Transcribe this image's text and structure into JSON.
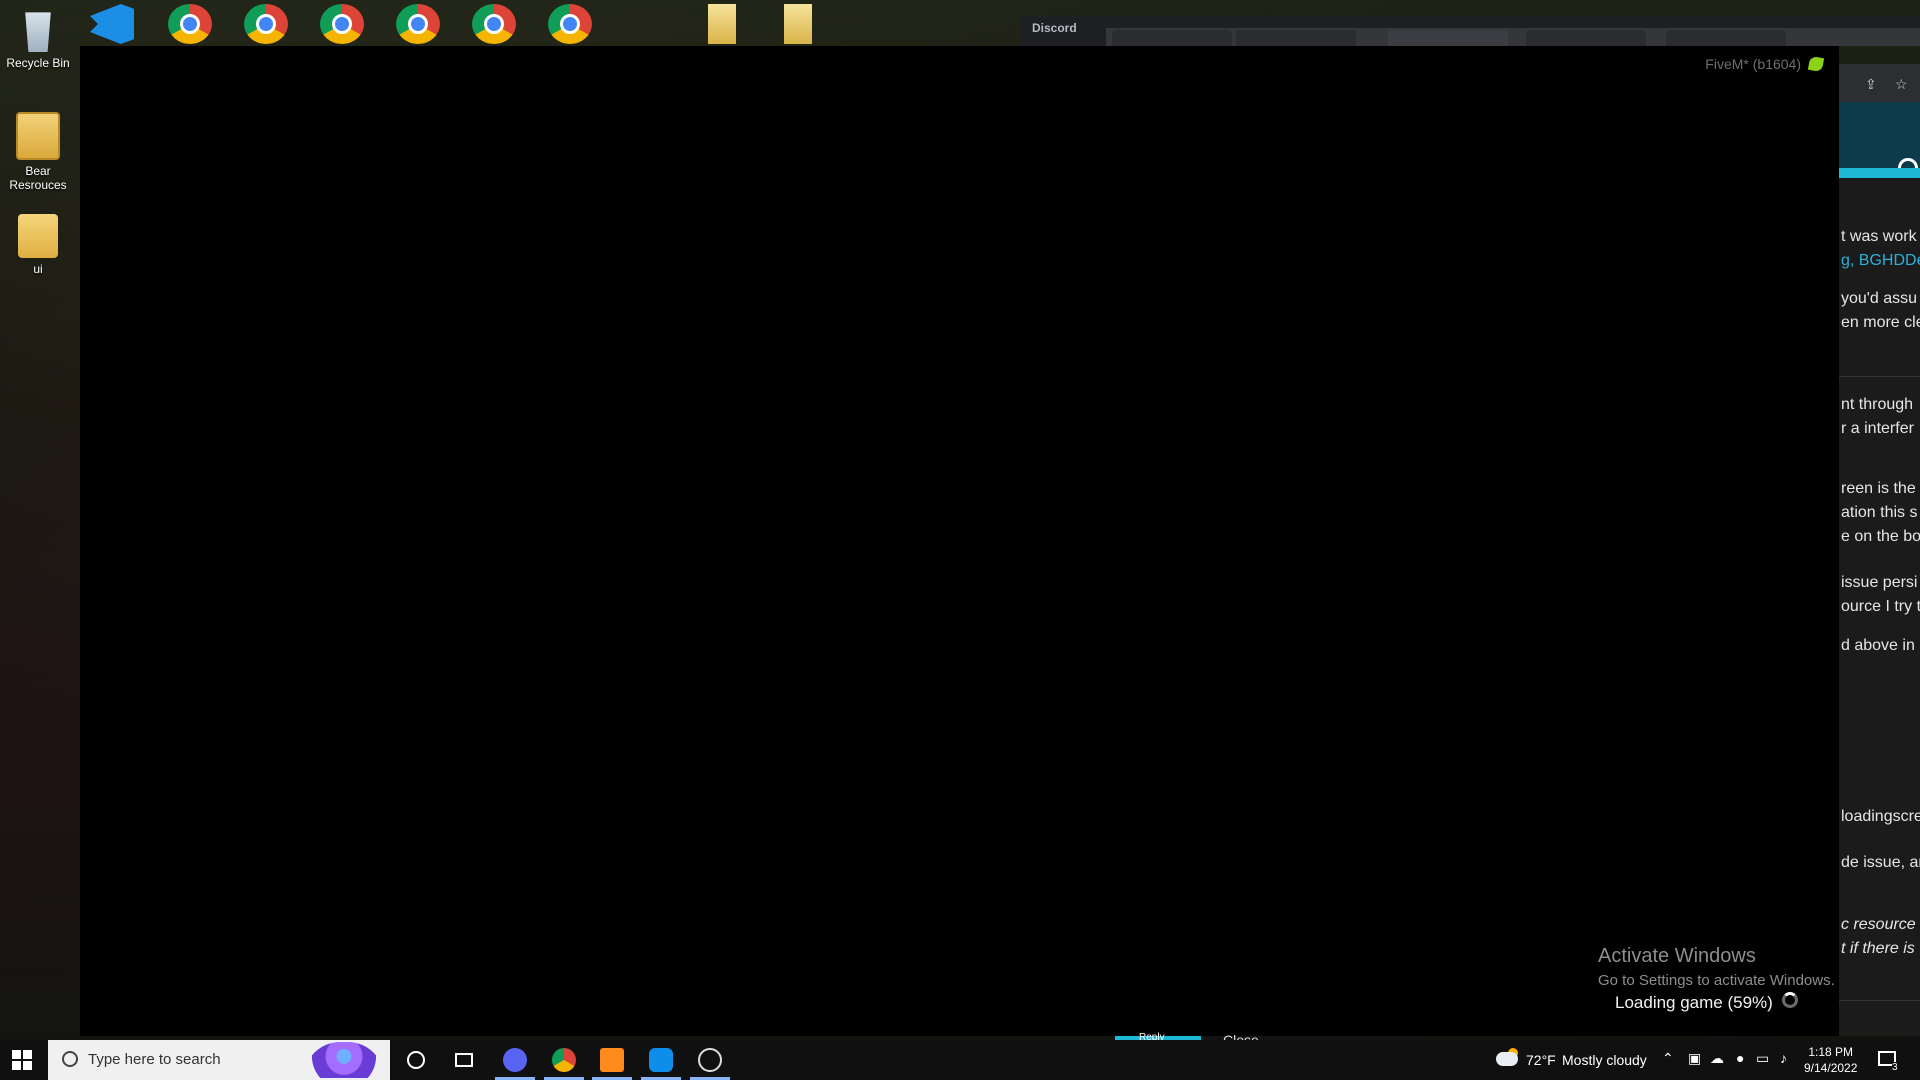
{
  "desktop": {
    "icons": [
      {
        "label": "Recycle Bin"
      },
      {
        "label": "Bear\nResrouces"
      },
      {
        "label": "ui"
      }
    ]
  },
  "discord": {
    "label": "Discord"
  },
  "game_window": {
    "title": "FiveM* (b1604)",
    "loading_text": "Loading game (59%)",
    "loading_progress": 0.59
  },
  "activation": {
    "title": "Activate Windows",
    "subtitle": "Go to Settings to activate Windows."
  },
  "background_page": {
    "lines": [
      "t was work",
      "g, BGHDDe",
      "you'd assu",
      "en more cle",
      "nt through",
      "r a interfer",
      "reen is the",
      "ation this s",
      "e on the bo",
      "issue persi",
      "ource I try t",
      "d above in",
      "loadingscre",
      "de issue, an",
      "c resource d",
      "t if there is"
    ],
    "reply_label": "Reply",
    "close_label": "Close"
  },
  "taskbar": {
    "search_placeholder": "Type here to search",
    "weather_temp": "72°F",
    "weather_desc": "Mostly cloudy",
    "time": "1:18 PM",
    "date": "9/14/2022",
    "notification_count": "3"
  }
}
